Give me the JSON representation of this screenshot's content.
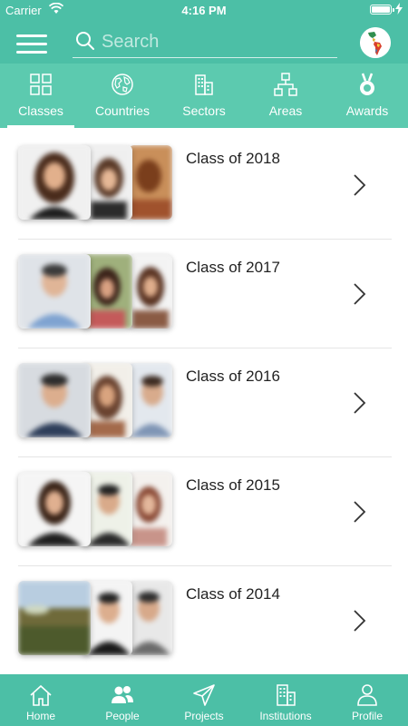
{
  "status_bar": {
    "carrier": "Carrier",
    "time": "4:16 PM"
  },
  "header": {
    "search_placeholder": "Search",
    "menu_icon": "hamburger-menu-icon",
    "avatar_icon": "americas-map-avatar"
  },
  "tabs": [
    {
      "label": "Classes",
      "icon": "grid-icon",
      "active": true
    },
    {
      "label": "Countries",
      "icon": "globe-icon",
      "active": false
    },
    {
      "label": "Sectors",
      "icon": "buildings-icon",
      "active": false
    },
    {
      "label": "Areas",
      "icon": "hierarchy-icon",
      "active": false
    },
    {
      "label": "Awards",
      "icon": "medal-icon",
      "active": false
    }
  ],
  "classes": [
    {
      "title": "Class of 2018"
    },
    {
      "title": "Class of 2017"
    },
    {
      "title": "Class of 2016"
    },
    {
      "title": "Class of 2015"
    },
    {
      "title": "Class of 2014"
    }
  ],
  "bottom_nav": [
    {
      "label": "Home",
      "icon": "home-icon"
    },
    {
      "label": "People",
      "icon": "people-icon"
    },
    {
      "label": "Projects",
      "icon": "paper-plane-icon"
    },
    {
      "label": "Institutions",
      "icon": "building-icon"
    },
    {
      "label": "Profile",
      "icon": "person-icon"
    }
  ],
  "colors": {
    "primary": "#4cbfa6",
    "tabs_bg": "#5ccaaf",
    "text": "#222222",
    "separator": "#e5e5e5"
  }
}
